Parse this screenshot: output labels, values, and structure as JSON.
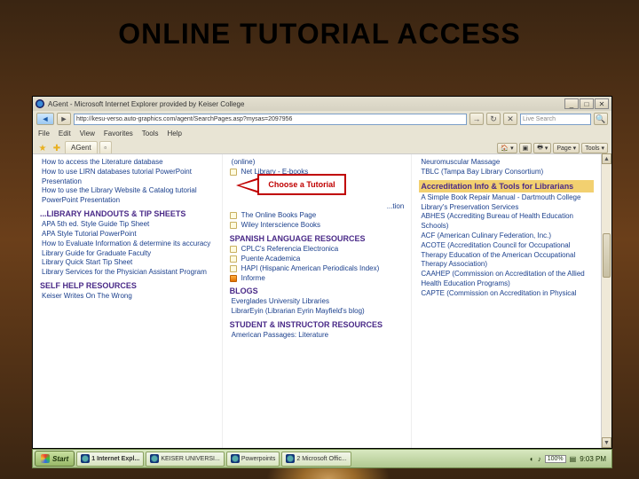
{
  "slide": {
    "title": "ONLINE TUTORIAL ACCESS"
  },
  "callout": {
    "text": "Choose a Tutorial"
  },
  "browser": {
    "title": "AGent - Microsoft Internet Explorer provided by Keiser College",
    "address": "http://kesu-verso.auto-graphics.com/agent/SearchPages.asp?mysas=2097956",
    "search_placeholder": "Live Search",
    "menus": [
      "File",
      "Edit",
      "View",
      "Favorites",
      "Tools",
      "Help"
    ],
    "tab_label": "AGent",
    "toolbar": {
      "home": "▾",
      "print": "▾",
      "page": "Page ▾",
      "tools": "Tools ▾"
    },
    "winbtns": {
      "min": "_",
      "max": "□",
      "close": "✕"
    }
  },
  "col1": {
    "items_top": [
      "How to access the Literature database",
      "How to use LIRN databases tutorial PowerPoint Presentation",
      "How to use the Library Website & Catalog tutorial PowerPoint Presentation"
    ],
    "hdr1": "...LIBRARY HANDOUTS & TIP SHEETS",
    "items1": [
      "APA 5th ed. Style Guide Tip Sheet",
      "APA Style Tutorial PowerPoint",
      "How to Evaluate Information & determine its accuracy",
      "Library Guide for Graduate Faculty",
      "Library Quick Start Tip Sheet",
      "Library Services for the Physician Assistant Program"
    ],
    "hdr2": "SELF HELP RESOURCES",
    "items2": [
      "Keiser Writes On The Wrong"
    ]
  },
  "col2": {
    "items_top": [
      "(online)",
      "Net Library - E-books"
    ],
    "hidden1": "...tion",
    "items_mid": [
      "The Online Books Page",
      "Wiley Interscience Books"
    ],
    "hdr1": "SPANISH LANGUAGE RESOURCES",
    "items1": [
      "CPLC's Referencia Electronica",
      "Puente Academica",
      "HAPI (Hispanic American Periodicals Index)",
      "Informe"
    ],
    "hdr2": "BLOGS",
    "items2": [
      "Everglades University Libraries",
      "LibrarEyin (Librarian Eyrin Mayfield's blog)"
    ],
    "hdr3": "STUDENT & INSTRUCTOR RESOURCES",
    "items3": [
      "American Passages: Literature"
    ]
  },
  "col3": {
    "items_top": [
      "Neuromuscular Massage",
      "TBLC (Tampa Bay Library Consortium)"
    ],
    "hdr1": "Accreditation Info & Tools for Librarians",
    "items1": [
      "A Simple Book Repair Manual - Dartmouth College Library's Preservation Services",
      "ABHES (Accrediting Bureau of Health Education Schools)",
      "ACF (American Culinary Federation, Inc.)",
      "ACOTE (Accreditation Council for Occupational Therapy Education of the American Occupational Therapy Association)",
      "CAAHEP (Commission on Accreditation of the Allied Health Education Programs)",
      "CAPTE (Commission on Accreditation in Physical"
    ]
  },
  "taskbar": {
    "start": "Start",
    "items": [
      "1 Internet Expl...",
      "KEISER UNIVERSI...",
      "Powerpoints",
      "2 Microsoft Offic..."
    ],
    "tray_pct": "100%",
    "clock": "9:03 PM"
  }
}
